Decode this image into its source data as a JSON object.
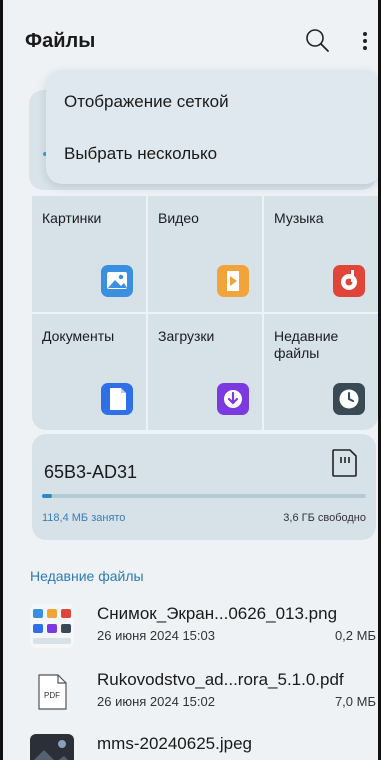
{
  "app": {
    "title": "Файлы"
  },
  "toolbar": {
    "search_icon": "search-icon",
    "more_icon": "more-vert-icon"
  },
  "menu": {
    "items": [
      {
        "label": "Отображение сеткой"
      },
      {
        "label": "Выбрать несколько"
      }
    ]
  },
  "categories": [
    {
      "label": "Картинки",
      "icon": "image-icon",
      "color": "#3a8fe0"
    },
    {
      "label": "Видео",
      "icon": "video-icon",
      "color": "#f0a43a"
    },
    {
      "label": "Музыка",
      "icon": "music-icon",
      "color": "#e0453a"
    },
    {
      "label": "Документы",
      "icon": "document-icon",
      "color": "#2f6fe8"
    },
    {
      "label": "Загрузки",
      "icon": "download-icon",
      "color": "#7b3ae0"
    },
    {
      "label": "Недавние файлы",
      "icon": "clock-icon",
      "color": "#3a4a55"
    }
  ],
  "sd_card": {
    "name": "65B3-AD31",
    "used": "118,4 МБ занято",
    "free": "3,6 ГБ свободно",
    "fraction_used": 0.03
  },
  "recent": {
    "title": "Недавние файлы",
    "files": [
      {
        "name": "Снимок_Экран...0626_013.png",
        "date": "26 июня 2024 15:03",
        "size": "0,2 МБ",
        "thumb": "screenshot-thumb"
      },
      {
        "name": "Rukovodstvo_ad...rora_5.1.0.pdf",
        "date": "26 июня 2024 15:02",
        "size": "7,0 МБ",
        "thumb": "pdf-icon"
      },
      {
        "name": "mms-20240625.jpeg",
        "date": "",
        "size": "",
        "thumb": "photo-thumb"
      }
    ]
  }
}
